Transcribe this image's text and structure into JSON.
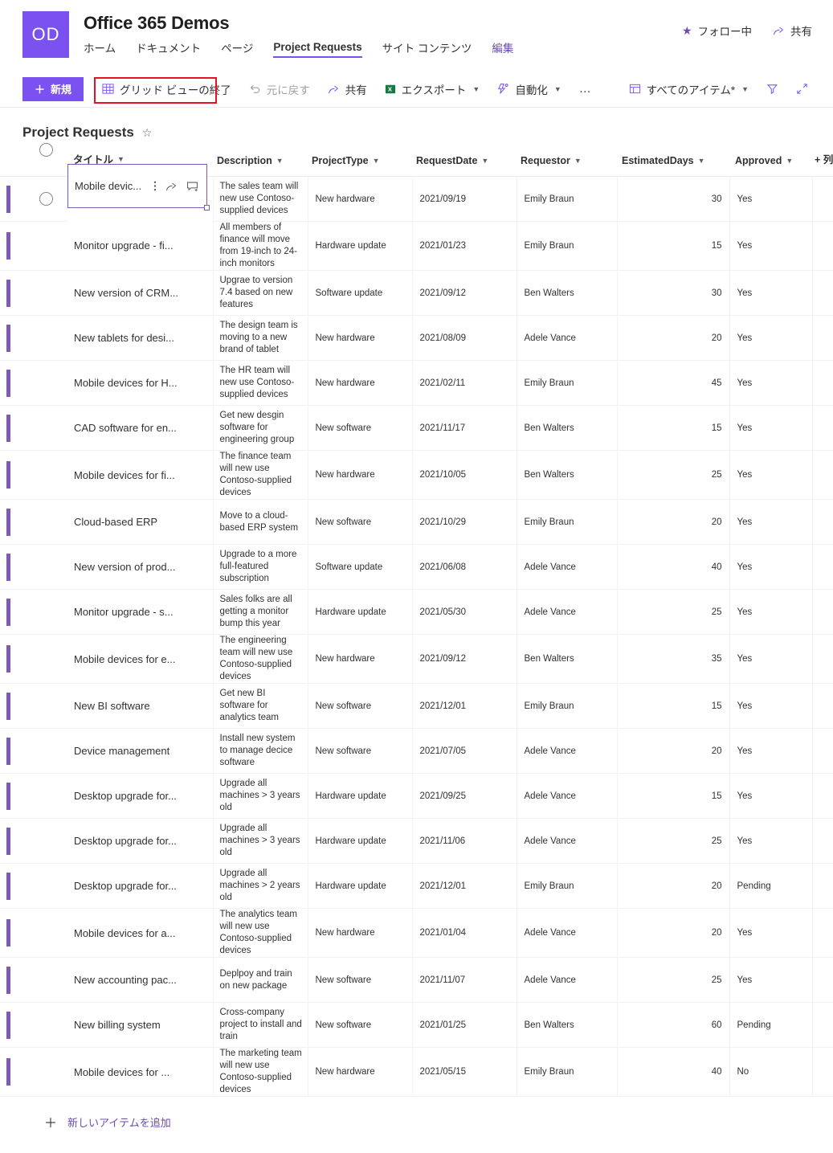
{
  "site": {
    "logo_initials": "OD",
    "title": "Office 365 Demos",
    "nav": [
      {
        "label": "ホーム",
        "active": false
      },
      {
        "label": "ドキュメント",
        "active": false
      },
      {
        "label": "ページ",
        "active": false
      },
      {
        "label": "Project Requests",
        "active": true
      },
      {
        "label": "サイト コンテンツ",
        "active": false
      },
      {
        "label": "編集",
        "active": false
      }
    ],
    "actions": {
      "follow_label": "フォロー中",
      "share_label": "共有"
    }
  },
  "commandbar": {
    "new_label": "新規",
    "exit_grid_label": "グリッド ビューの終了",
    "undo_label": "元に戻す",
    "share_label": "共有",
    "export_label": "エクスポート",
    "automate_label": "自動化",
    "more_label": "…",
    "view_label": "すべてのアイテム*"
  },
  "list": {
    "title": "Project Requests",
    "columns": [
      {
        "key": "title",
        "label": "タイトル"
      },
      {
        "key": "desc",
        "label": "Description"
      },
      {
        "key": "type",
        "label": "ProjectType"
      },
      {
        "key": "date",
        "label": "RequestDate"
      },
      {
        "key": "req",
        "label": "Requestor"
      },
      {
        "key": "days",
        "label": "EstimatedDays"
      },
      {
        "key": "approved",
        "label": "Approved"
      }
    ],
    "add_column_label": "+ 列を",
    "add_item_label": "新しいアイテムを追加",
    "rows": [
      {
        "title": "Mobile devic...",
        "desc": "The sales team will new use Contoso-supplied devices",
        "type": "New hardware",
        "date": "2021/09/19",
        "req": "Emily Braun",
        "days": "30",
        "approved": "Yes"
      },
      {
        "title": "Monitor upgrade - fi...",
        "desc": "All members of finance will move from 19-inch to 24-inch monitors",
        "type": "Hardware update",
        "date": "2021/01/23",
        "req": "Emily Braun",
        "days": "15",
        "approved": "Yes"
      },
      {
        "title": "New version of CRM...",
        "desc": "Upgrae to version 7.4 based on new features",
        "type": "Software update",
        "date": "2021/09/12",
        "req": "Ben Walters",
        "days": "30",
        "approved": "Yes"
      },
      {
        "title": "New tablets for desi...",
        "desc": "The design team is moving to a new brand of tablet",
        "type": "New hardware",
        "date": "2021/08/09",
        "req": "Adele Vance",
        "days": "20",
        "approved": "Yes"
      },
      {
        "title": "Mobile devices for H...",
        "desc": "The HR team will new use Contoso-supplied devices",
        "type": "New hardware",
        "date": "2021/02/11",
        "req": "Emily Braun",
        "days": "45",
        "approved": "Yes"
      },
      {
        "title": "CAD software for en...",
        "desc": "Get new desgin software for engineering group",
        "type": "New software",
        "date": "2021/11/17",
        "req": "Ben Walters",
        "days": "15",
        "approved": "Yes"
      },
      {
        "title": "Mobile devices for fi...",
        "desc": "The finance team will new use Contoso-supplied devices",
        "type": "New hardware",
        "date": "2021/10/05",
        "req": "Ben Walters",
        "days": "25",
        "approved": "Yes"
      },
      {
        "title": "Cloud-based ERP",
        "desc": "Move to a cloud-based ERP system",
        "type": "New software",
        "date": "2021/10/29",
        "req": "Emily Braun",
        "days": "20",
        "approved": "Yes"
      },
      {
        "title": "New version of prod...",
        "desc": "Upgrade to a more full-featured subscription",
        "type": "Software update",
        "date": "2021/06/08",
        "req": "Adele Vance",
        "days": "40",
        "approved": "Yes"
      },
      {
        "title": "Monitor upgrade - s...",
        "desc": "Sales folks are all getting a monitor bump this year",
        "type": "Hardware update",
        "date": "2021/05/30",
        "req": "Adele Vance",
        "days": "25",
        "approved": "Yes"
      },
      {
        "title": "Mobile devices for e...",
        "desc": "The engineering team will new use Contoso-supplied devices",
        "type": "New hardware",
        "date": "2021/09/12",
        "req": "Ben Walters",
        "days": "35",
        "approved": "Yes"
      },
      {
        "title": "New BI software",
        "desc": "Get new BI software for analytics team",
        "type": "New software",
        "date": "2021/12/01",
        "req": "Emily Braun",
        "days": "15",
        "approved": "Yes"
      },
      {
        "title": "Device management",
        "desc": "Install new system to manage decice software",
        "type": "New software",
        "date": "2021/07/05",
        "req": "Adele Vance",
        "days": "20",
        "approved": "Yes"
      },
      {
        "title": "Desktop upgrade for...",
        "desc": "Upgrade all machines > 3 years old",
        "type": "Hardware update",
        "date": "2021/09/25",
        "req": "Adele Vance",
        "days": "15",
        "approved": "Yes"
      },
      {
        "title": "Desktop upgrade for...",
        "desc": "Upgrade all machines > 3 years old",
        "type": "Hardware update",
        "date": "2021/11/06",
        "req": "Adele Vance",
        "days": "25",
        "approved": "Yes"
      },
      {
        "title": "Desktop upgrade for...",
        "desc": "Upgrade all machines > 2 years old",
        "type": "Hardware update",
        "date": "2021/12/01",
        "req": "Emily Braun",
        "days": "20",
        "approved": "Pending"
      },
      {
        "title": "Mobile devices for a...",
        "desc": "The analytics team will new use Contoso-supplied devices",
        "type": "New hardware",
        "date": "2021/01/04",
        "req": "Adele Vance",
        "days": "20",
        "approved": "Yes"
      },
      {
        "title": "New accounting pac...",
        "desc": "Deplpoy and train on new package",
        "type": "New software",
        "date": "2021/11/07",
        "req": "Adele Vance",
        "days": "25",
        "approved": "Yes"
      },
      {
        "title": "New billing system",
        "desc": "Cross-company project to install and train",
        "type": "New software",
        "date": "2021/01/25",
        "req": "Ben Walters",
        "days": "60",
        "approved": "Pending"
      },
      {
        "title": "Mobile devices for ...",
        "desc": "The marketing team will new use Contoso-supplied devices",
        "type": "New hardware",
        "date": "2021/05/15",
        "req": "Emily Braun",
        "days": "40",
        "approved": "No"
      }
    ]
  },
  "colors": {
    "brand_purple": "#7b52f0",
    "row_accent": "#7e5bb5",
    "link_purple": "#6b4ca8",
    "highlight_red": "#e81123"
  }
}
